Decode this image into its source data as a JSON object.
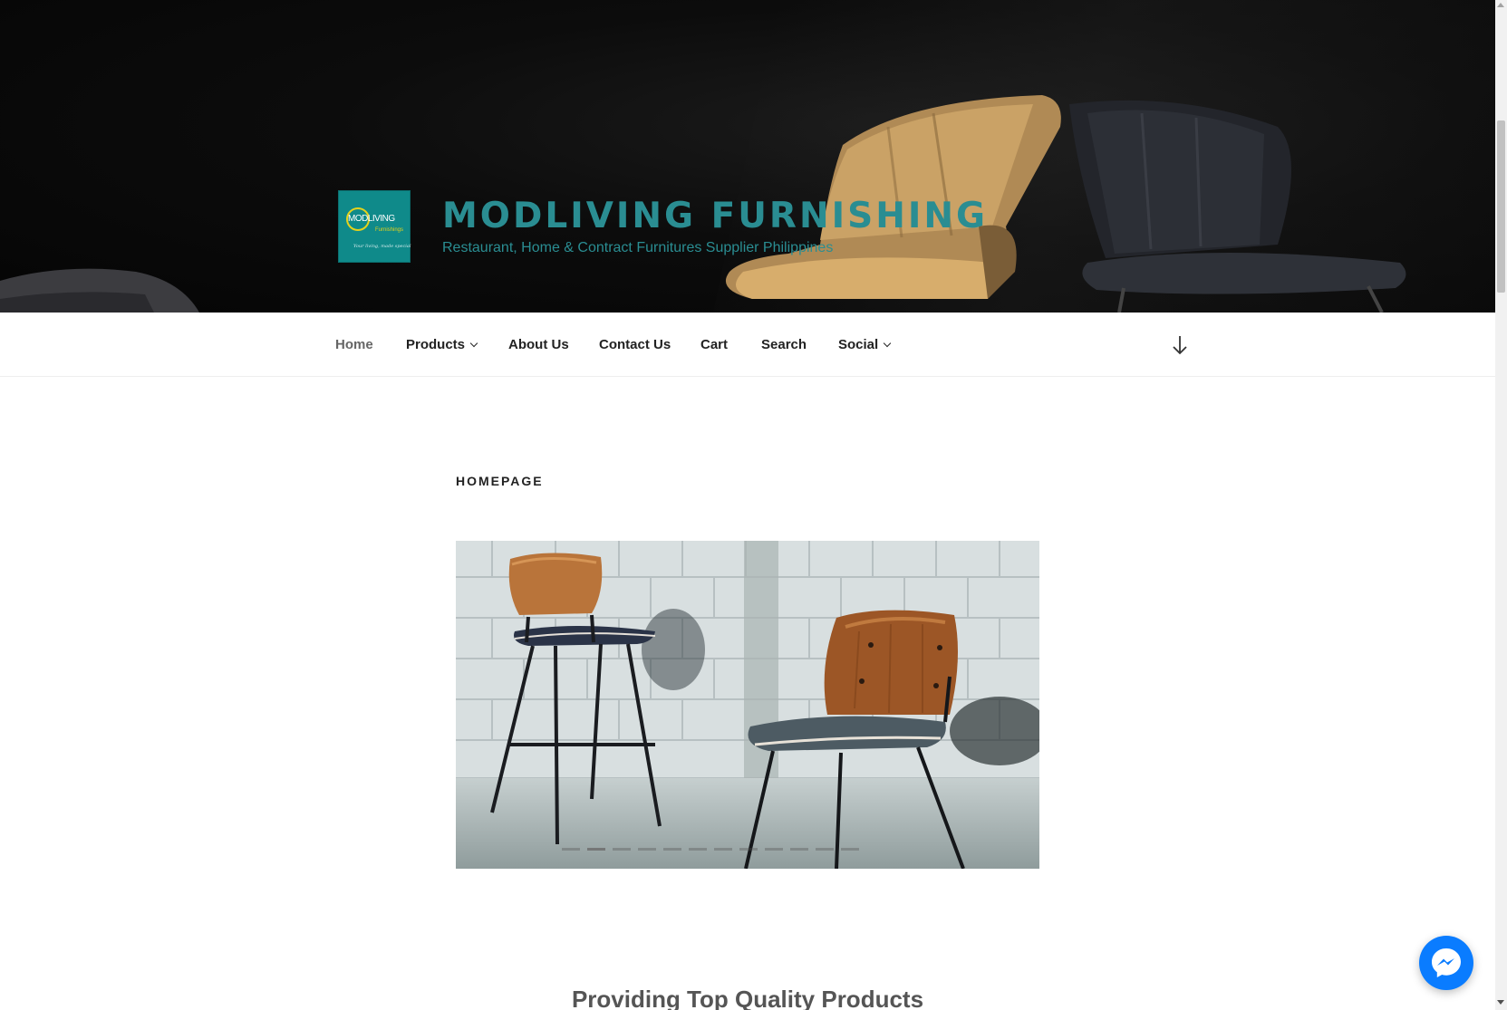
{
  "site": {
    "title": "MODLIVING FURNISHING",
    "tagline": "Restaurant, Home & Contract Furnitures Supplier Philippines",
    "logo": {
      "text_main": "MODLIVING",
      "text_sub": "Furnishings",
      "text_script": "Your living, made special",
      "bg_color": "#0f8a8a",
      "accent_color": "#e5d21b"
    }
  },
  "nav": {
    "items": [
      {
        "label": "Home",
        "active": true,
        "has_dropdown": false
      },
      {
        "label": "Products",
        "active": false,
        "has_dropdown": true
      },
      {
        "label": "About Us",
        "active": false,
        "has_dropdown": false
      },
      {
        "label": "Contact Us",
        "active": false,
        "has_dropdown": false
      },
      {
        "label": "Cart",
        "active": false,
        "has_dropdown": false
      },
      {
        "label": "Search",
        "active": false,
        "has_dropdown": false
      },
      {
        "label": "Social",
        "active": false,
        "has_dropdown": true
      }
    ],
    "scroll_icon": "arrow-down-icon"
  },
  "content": {
    "page_title": "HOMEPAGE",
    "slider": {
      "slide_count": 12,
      "active_index": 1
    },
    "section_heading": "Providing Top Quality Products"
  },
  "messenger": {
    "icon": "messenger-icon",
    "color": "#0a7cff"
  },
  "colors": {
    "brand": "#2a8d92",
    "nav_text": "#222222",
    "nav_active": "#666666"
  }
}
